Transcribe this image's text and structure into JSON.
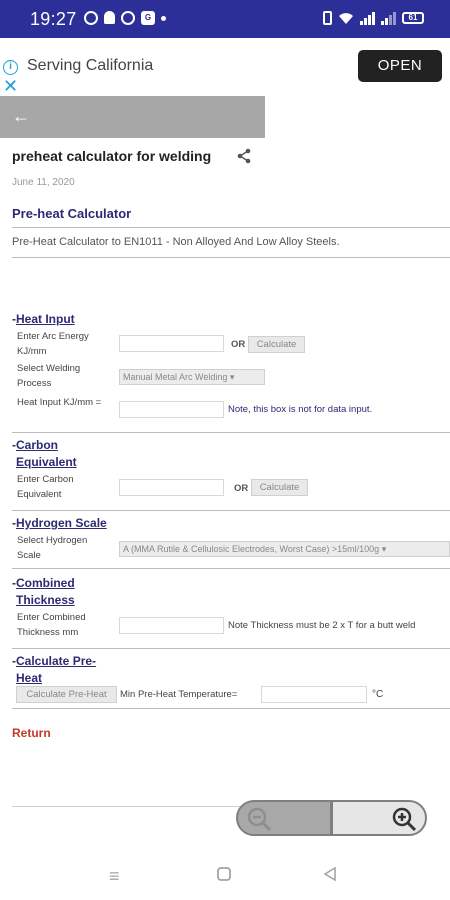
{
  "statusbar": {
    "time": "19:27",
    "battery": "61"
  },
  "ad": {
    "text": "Serving California",
    "open_label": "OPEN"
  },
  "page": {
    "title": "preheat calculator for welding",
    "date": "June 11, 2020",
    "section_heading": "Pre-heat Calculator",
    "description": "Pre-Heat Calculator to EN1011  -  Non Alloyed And Low Alloy Steels."
  },
  "heat_input": {
    "title": "Heat Input",
    "arc_energy_label": "Enter Arc Energy KJ/mm",
    "or_label": "OR",
    "calculate_label": "Calculate",
    "process_label": "Select Welding Process",
    "process_value": "Manual Metal Arc Welding",
    "heat_input_label": "Heat Input KJ/mm =",
    "note": "Note, this box is not for data input."
  },
  "carbon": {
    "title_line1": "Carbon",
    "title_line2": "Equivalent",
    "label": "Enter Carbon Equivalent",
    "or_label": "OR",
    "calculate_label": "Calculate"
  },
  "hydrogen": {
    "title": "Hydrogen Scale",
    "label": "Select Hydrogen Scale",
    "value": "A (MMA Rutile & Cellulosic Electrodes, Worst Case) >15ml/100g"
  },
  "thickness": {
    "title_line1": "Combined",
    "title_line2": "Thickness",
    "label": "Enter Combined Thickness mm",
    "note": "Note Thickness must be 2 x T for a butt weld"
  },
  "preheat": {
    "title_line1": "Calculate Pre-",
    "title_line2": "Heat",
    "button_label": "Calculate Pre-Heat",
    "result_label": "Min Pre-Heat Temperature=",
    "unit": "°C"
  },
  "return_label": "Return",
  "colors": {
    "statusbar": "#2b2f97",
    "heading": "#2c2a73",
    "return": "#c0392b"
  }
}
